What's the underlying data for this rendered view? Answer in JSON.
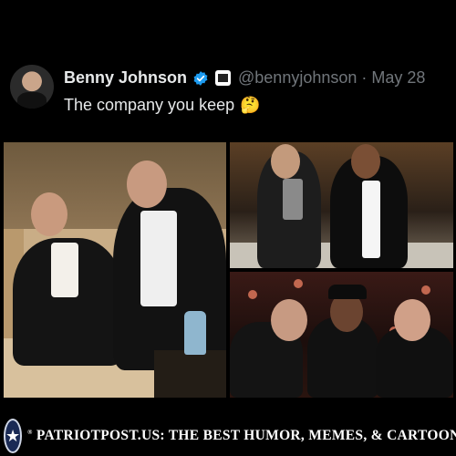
{
  "tweet": {
    "display_name": "Benny Johnson",
    "handle": "@bennyjohnson",
    "separator": "·",
    "date": "May 28",
    "text": "The company you keep",
    "emoji": "🤔",
    "verified_color": "#1d9bf0"
  },
  "images": [
    {
      "label": "photo-sofa"
    },
    {
      "label": "photo-stage"
    },
    {
      "label": "photo-event"
    }
  ],
  "footer": {
    "text": "PATRIOTPOST.US: THE BEST HUMOR, MEMES, & CARTOONS",
    "trademark": "®",
    "badge_glyph": "★"
  },
  "colors": {
    "background": "#000000",
    "text": "#e7e9ea",
    "secondary_text": "#71767b"
  }
}
